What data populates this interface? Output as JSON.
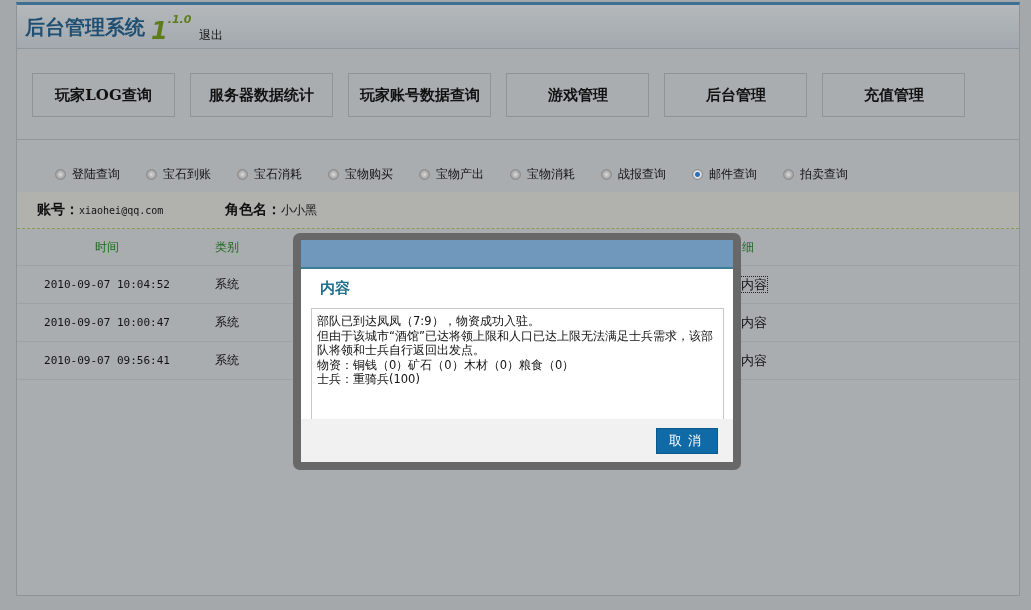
{
  "header": {
    "title": "后台管理系统",
    "version_major": "1",
    "version_minor": ".1.0",
    "logout": "退出"
  },
  "nav": [
    {
      "label": "玩家LOG查询"
    },
    {
      "label": "服务器数据统计"
    },
    {
      "label": "玩家账号数据查询"
    },
    {
      "label": "游戏管理"
    },
    {
      "label": "后台管理"
    },
    {
      "label": "充值管理"
    }
  ],
  "radios": [
    {
      "label": "登陆查询",
      "selected": false
    },
    {
      "label": "宝石到账",
      "selected": false
    },
    {
      "label": "宝石消耗",
      "selected": false
    },
    {
      "label": "宝物购买",
      "selected": false
    },
    {
      "label": "宝物产出",
      "selected": false
    },
    {
      "label": "宝物消耗",
      "selected": false
    },
    {
      "label": "战报查询",
      "selected": false
    },
    {
      "label": "邮件查询",
      "selected": true
    },
    {
      "label": "拍卖查询",
      "selected": false
    }
  ],
  "account": {
    "label": "账号：",
    "value": "xiaohei@qq.com",
    "role_label": "角色名：",
    "role_value": "小小黑"
  },
  "table": {
    "columns": [
      "时间",
      "类别",
      "细"
    ],
    "rows": [
      {
        "time": "2010-09-07 10:04:52",
        "category": "系统",
        "detail": "内容",
        "focused": true
      },
      {
        "time": "2010-09-07 10:00:47",
        "category": "系统",
        "detail": "内容",
        "focused": false
      },
      {
        "time": "2010-09-07 09:56:41",
        "category": "系统",
        "detail": "内容",
        "focused": false
      }
    ]
  },
  "modal": {
    "heading": "内容",
    "body": [
      "部队已到达凤凤（7:9），物资成功入驻。",
      "但由于该城市“酒馆”已达将领上限和人口已达上限无法满足士兵需求，该部队将领和士兵自行返回出发点。",
      "物资：铜钱（0）矿石（0）木材（0）粮食（0）",
      "士兵：重骑兵(100)"
    ],
    "cancel": "取消"
  }
}
